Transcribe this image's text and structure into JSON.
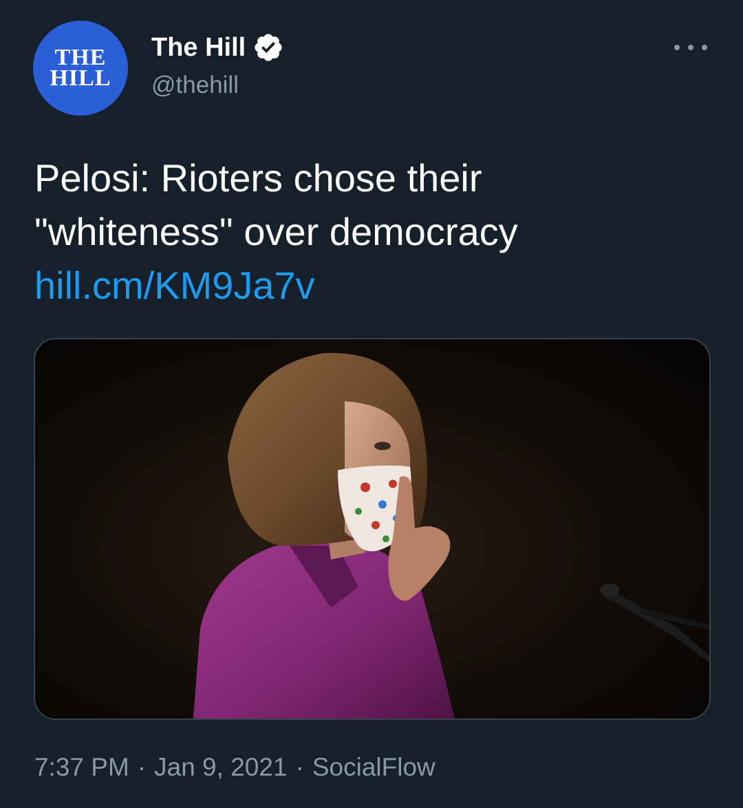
{
  "author": {
    "display_name": "The Hill",
    "handle": "@thehill",
    "avatar_text": [
      "THE",
      "HILL"
    ],
    "verified": true,
    "avatar_color": "#2a5fd8"
  },
  "tweet": {
    "text_line1": "Pelosi: Rioters chose their",
    "text_line2": "\"whiteness\" over democracy",
    "link": "hill.cm/KM9Ja7v"
  },
  "meta": {
    "time": "7:37 PM",
    "separator": "·",
    "date": "Jan 9, 2021",
    "source": "SocialFlow"
  },
  "icons": {
    "verified": "verified-badge-icon",
    "more": "more-options-icon"
  },
  "colors": {
    "background": "#15202b",
    "link": "#1d9bf0",
    "secondary_text": "#8b98a5"
  }
}
